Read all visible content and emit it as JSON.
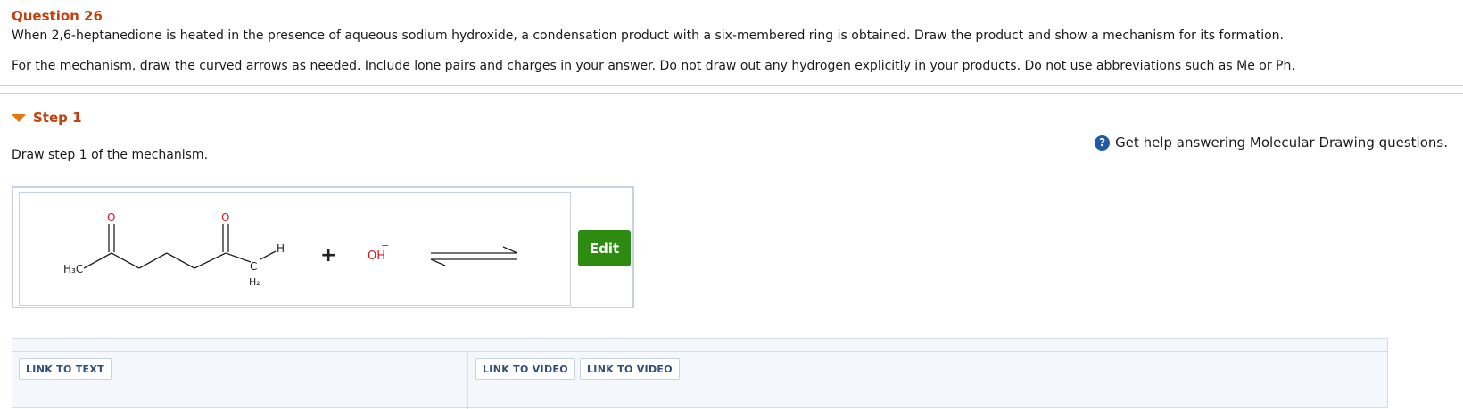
{
  "question": {
    "title": "Question 26",
    "text_line1": "When 2,6-heptanedione is heated in the presence of aqueous sodium hydroxide, a condensation product with a six-membered ring is obtained. Draw the product and show a mechanism for its formation.",
    "text_line2": "For the mechanism, draw the curved arrows as needed. Include lone pairs and charges in your answer.  Do not draw out any hydrogen explicitly in your products. Do not use abbreviations such as Me or Ph."
  },
  "step": {
    "label": "Step 1",
    "prompt": "Draw step 1 of the mechanism."
  },
  "help": {
    "icon": "?",
    "text": "Get help answering Molecular Drawing questions."
  },
  "molecule": {
    "left_group": "H₃C",
    "oxygen_1": "O",
    "oxygen_2": "O",
    "carbon": "C",
    "hydrogen": "H",
    "ch2_h": "H₂",
    "plus": "+",
    "hydroxide": "OH",
    "hydroxide_charge": "−"
  },
  "edit_button": "Edit",
  "links": {
    "text": "LINK TO TEXT",
    "video_1": "LINK TO VIDEO",
    "video_2": "LINK TO VIDEO"
  },
  "colors": {
    "title": "#c2410c",
    "accent": "#e8740c",
    "oxygen": "#d11a1a",
    "edit_button": "#2e8b12",
    "help_icon": "#1e5aa8"
  }
}
